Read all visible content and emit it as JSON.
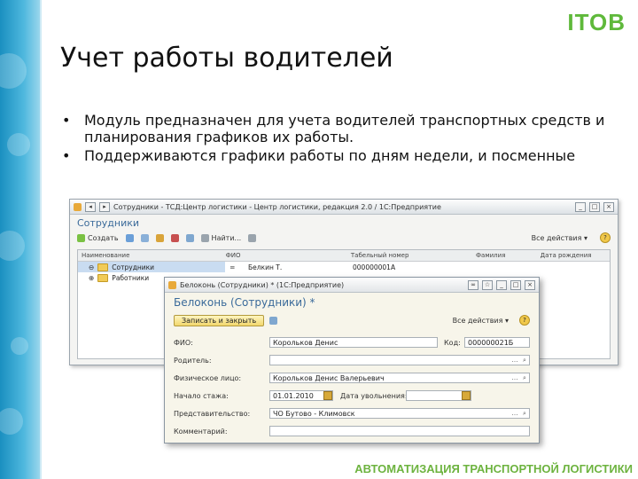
{
  "logo": "ITOB",
  "title": "Учет работы водителей",
  "bullets": [
    "Модуль предназначен для учета  водителей транспортных средств и планирования графиков их работы.",
    "Поддерживаются графики работы по дням недели, и посменные"
  ],
  "bullet_symbol": "•",
  "footer": "АВТОМАТИЗАЦИЯ ТРАНСПОРТНОЙ ЛОГИСТИКИ",
  "colors": {
    "accent_green": "#6db33f",
    "sidebar_blue": "#1a8fc0",
    "form_header": "#3a6a9a"
  },
  "back_window": {
    "title": "Сотрудники - ТСД:Центр логистики - Центр логистики, редакция 2.0 / 1С:Предприятие",
    "header": "Сотрудники",
    "toolbar": {
      "create": "Создать",
      "find": "Найти...",
      "actions": "Все действия ▾"
    },
    "columns": [
      "Наименование",
      "ФИО",
      "Табельный номер",
      "Фамилия",
      "Дата рождения"
    ],
    "tree": [
      "Сотрудники",
      "Работники"
    ],
    "rows": [
      {
        "name": "Белкин Т.",
        "code": "000000001А"
      }
    ]
  },
  "front_window": {
    "title": "Белоконь (Сотрудники) * (1С:Предприятие)",
    "header": "Белоконь (Сотрудники) *",
    "save_label": "Записать и закрыть",
    "actions": "Все действия ▾",
    "help": "?",
    "fields": {
      "fio_label": "ФИО:",
      "fio_value": "Корольков Денис",
      "code_label": "Код:",
      "code_value": "000000021Б",
      "parent_label": "Родитель:",
      "parent_value": "",
      "fullname_label": "Физическое лицо:",
      "fullname_value": "Корольков Денис Валерьевич",
      "start_label": "Начало стажа:",
      "start_value": "01.01.2010",
      "end_label": "Дата увольнения:",
      "end_value": "",
      "division_label": "Представительство:",
      "division_value": "ЧО Бутово - Климовск",
      "comment_label": "Комментарий:",
      "comment_value": ""
    }
  }
}
